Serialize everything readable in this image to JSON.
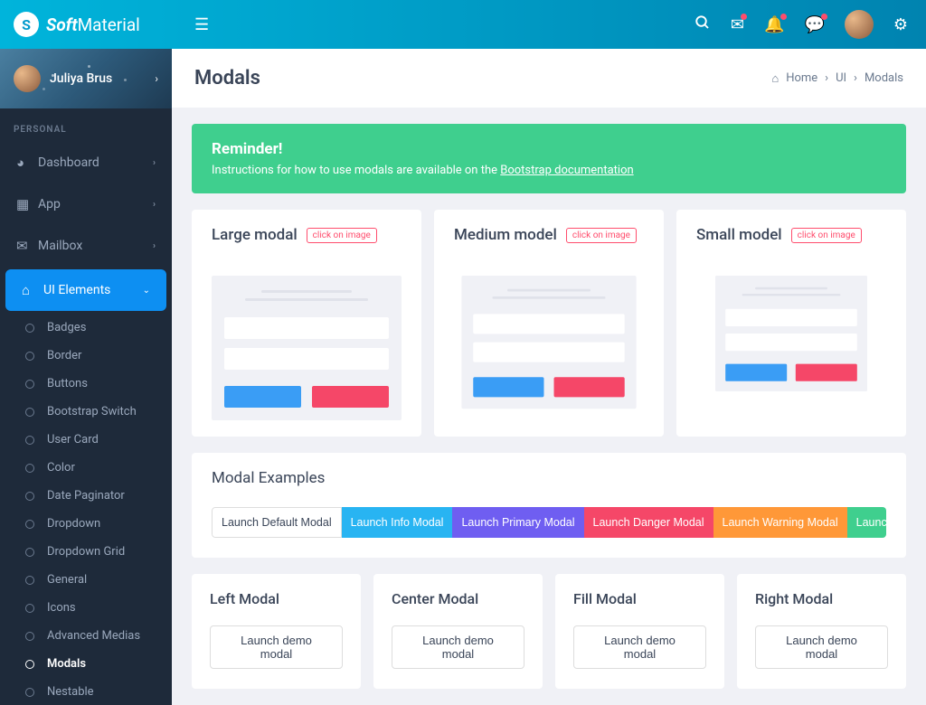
{
  "header": {
    "brand_soft": "Soft",
    "brand_mat": "Material",
    "logo_letter": "S"
  },
  "user": {
    "name": "Juliya Brus"
  },
  "sidebar": {
    "section_personal": "PERSONAL",
    "items": [
      {
        "label": "Dashboard",
        "icon": "📊"
      },
      {
        "label": "App",
        "icon": "▦"
      },
      {
        "label": "Mailbox",
        "icon": "✉"
      },
      {
        "label": "UI Elements",
        "icon": "💻"
      }
    ],
    "sub_items": [
      "Badges",
      "Border",
      "Buttons",
      "Bootstrap Switch",
      "User Card",
      "Color",
      "Date Paginator",
      "Dropdown",
      "Dropdown Grid",
      "General",
      "Icons",
      "Advanced Medias",
      "Modals",
      "Nestable"
    ]
  },
  "page": {
    "title": "Modals"
  },
  "breadcrumb": {
    "home": "Home",
    "ui": "UI",
    "modals": "Modals"
  },
  "alert": {
    "title": "Reminder!",
    "text_prefix": "Instructions for how to use modals are available on the ",
    "link": "Bootstrap documentation"
  },
  "modal_cards": {
    "large": "Large modal",
    "medium": "Medium model",
    "small": "Small model",
    "click_label": "click on image"
  },
  "examples": {
    "title": "Modal Examples",
    "buttons": {
      "default": "Launch Default Modal",
      "info": "Launch Info Modal",
      "primary": "Launch Primary Modal",
      "danger": "Launch Danger Modal",
      "warning": "Launch Warning Modal",
      "success": "Launch Success Modal"
    }
  },
  "position_modals": {
    "left": "Left Modal",
    "center": "Center Modal",
    "fill": "Fill Modal",
    "right": "Right Modal",
    "demo_btn": "Launch demo modal"
  },
  "colors": {
    "accent": "#0d8ff2",
    "success": "#3fcf8e",
    "danger": "#f54768",
    "warning": "#ff9838",
    "info": "#28b4f2",
    "primary": "#6f5ef1"
  }
}
